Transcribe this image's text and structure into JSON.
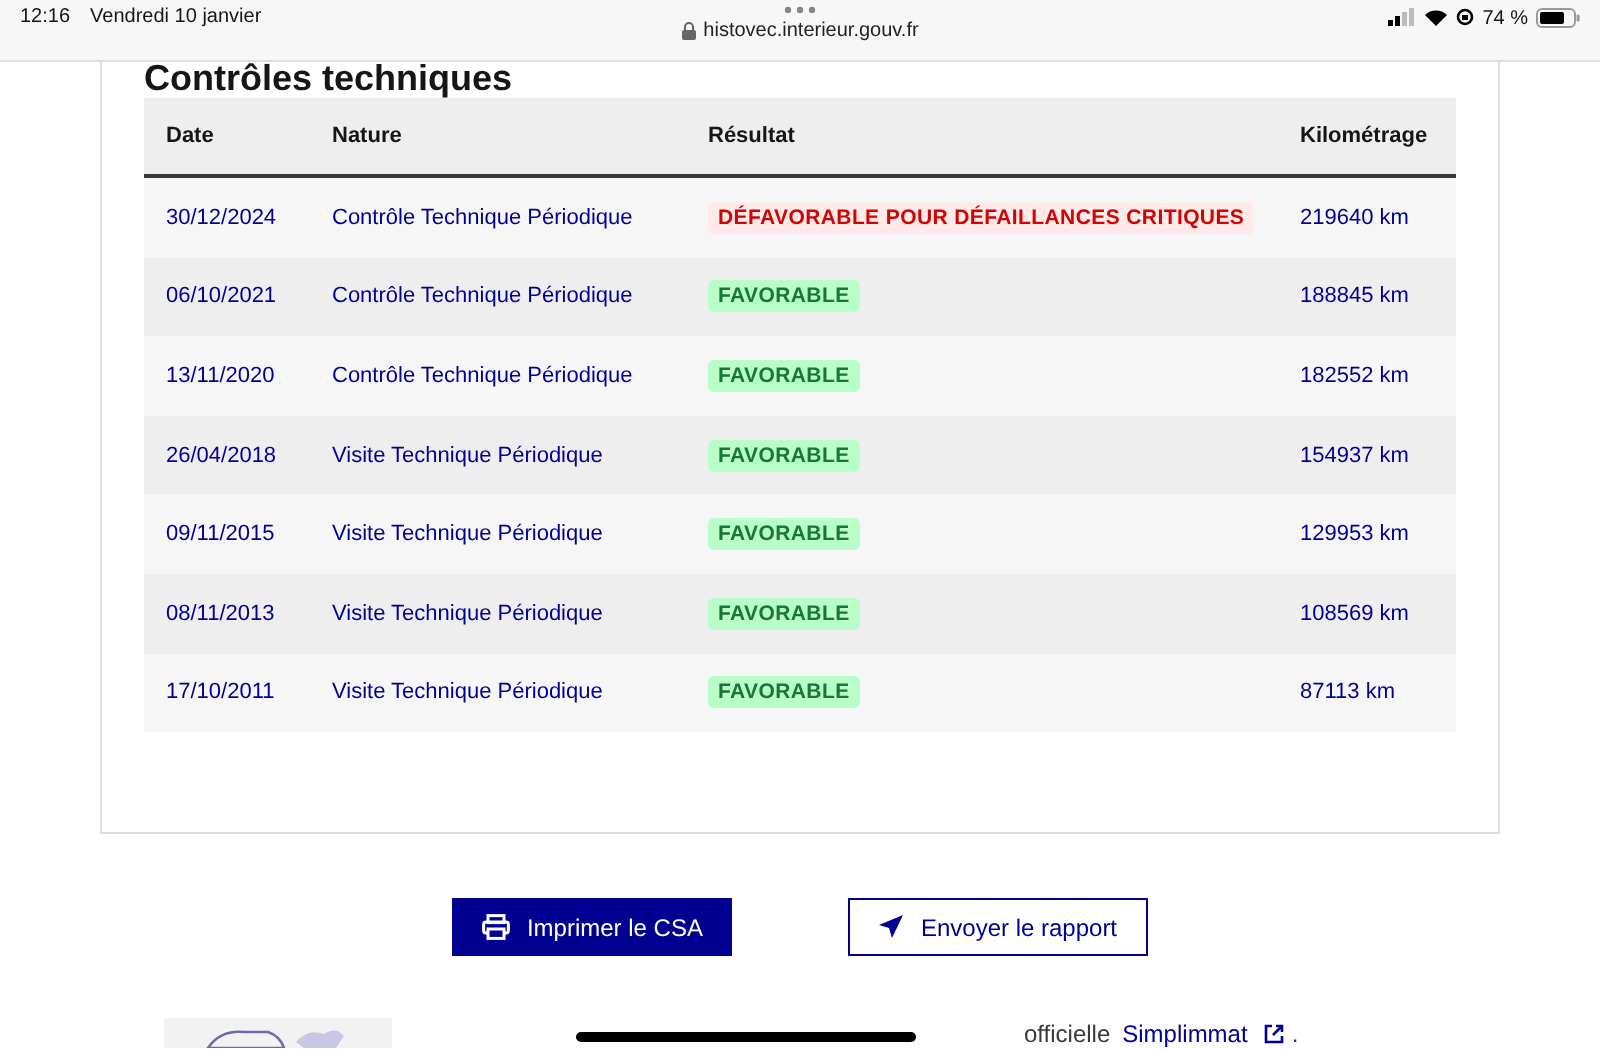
{
  "status_bar": {
    "time": "12:16",
    "date": "Vendredi 10 janvier",
    "url": "histovec.interieur.gouv.fr",
    "battery": "74 %"
  },
  "section": {
    "title": "Contrôles techniques",
    "table": {
      "columns": [
        "Date",
        "Nature",
        "Résultat",
        "Kilométrage"
      ],
      "rows": [
        {
          "date": "30/12/2024",
          "nature": "Contrôle Technique Périodique",
          "result": {
            "text": "DÉFAVORABLE POUR DÉFAILLANCES CRITIQUES",
            "kind": "error"
          },
          "mileage": "219640 km"
        },
        {
          "date": "06/10/2021",
          "nature": "Contrôle Technique Périodique",
          "result": {
            "text": "FAVORABLE",
            "kind": "success"
          },
          "mileage": "188845 km"
        },
        {
          "date": "13/11/2020",
          "nature": "Contrôle Technique Périodique",
          "result": {
            "text": "FAVORABLE",
            "kind": "success"
          },
          "mileage": "182552 km"
        },
        {
          "date": "26/04/2018",
          "nature": "Visite Technique Périodique",
          "result": {
            "text": "FAVORABLE",
            "kind": "success"
          },
          "mileage": "154937 km"
        },
        {
          "date": "09/11/2015",
          "nature": "Visite Technique Périodique",
          "result": {
            "text": "FAVORABLE",
            "kind": "success"
          },
          "mileage": "129953 km"
        },
        {
          "date": "08/11/2013",
          "nature": "Visite Technique Périodique",
          "result": {
            "text": "FAVORABLE",
            "kind": "success"
          },
          "mileage": "108569 km"
        },
        {
          "date": "17/10/2011",
          "nature": "Visite Technique Périodique",
          "result": {
            "text": "FAVORABLE",
            "kind": "success"
          },
          "mileage": "87113 km"
        }
      ]
    }
  },
  "actions": [
    {
      "label": "Imprimer le CSA",
      "kind": "primary"
    },
    {
      "label": "Envoyer le rapport",
      "kind": "secondary"
    }
  ],
  "footer": {
    "text": "officielle",
    "link": "Simplimmat",
    "end": "."
  }
}
